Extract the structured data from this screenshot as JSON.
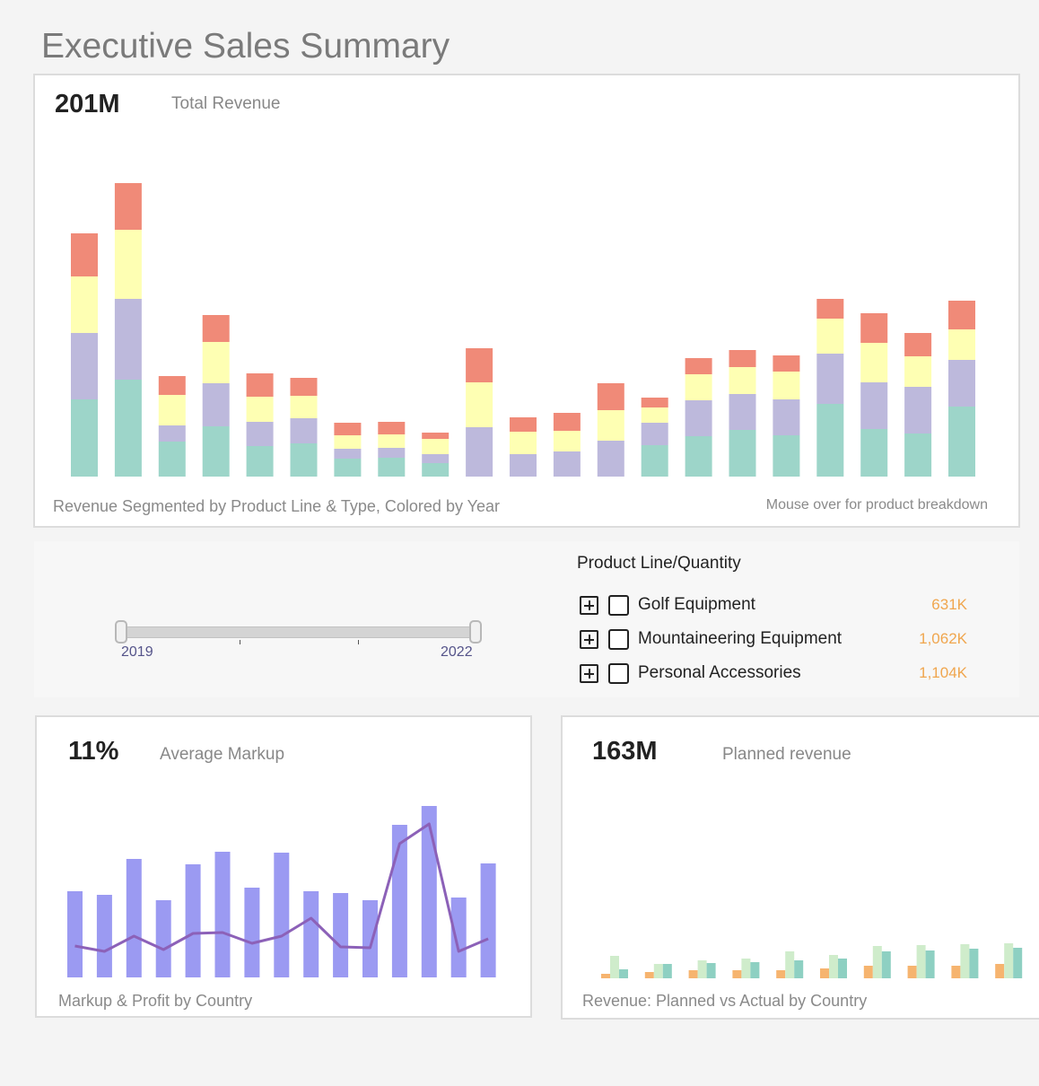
{
  "page": {
    "title": "Executive Sales Summary"
  },
  "revenue_panel": {
    "kpi_value": "201M",
    "kpi_label": "Total Revenue",
    "caption": "Revenue Segmented by Product Line & Type, Colored by Year",
    "hint": "Mouse over for product breakdown"
  },
  "filter": {
    "slider": {
      "min_label": "2019",
      "max_label": "2022"
    },
    "product_line_header": "Product Line/Quantity",
    "product_lines": [
      {
        "name": "Golf Equipment",
        "value": "631K"
      },
      {
        "name": "Mountaineering Equipment",
        "value": "1,062K"
      },
      {
        "name": "Personal Accessories",
        "value": "1,104K"
      }
    ]
  },
  "markup_panel": {
    "kpi_value": "11%",
    "kpi_label": "Average Markup",
    "caption": "Markup & Profit by Country"
  },
  "planned_panel": {
    "kpi_value": "163M",
    "kpi_label": "Planned revenue",
    "caption": "Revenue: Planned vs Actual by Country"
  },
  "chart_data": [
    {
      "type": "bar",
      "stacked": true,
      "title": "Revenue Segmented by Product Line & Type, Colored by Year",
      "colors": [
        "#9dd5c9",
        "#bdb9dc",
        "#feffb3",
        "#f08a78"
      ],
      "series": [
        {
          "values": [
            86,
            108,
            39,
            56,
            34,
            37,
            20,
            21,
            15,
            0,
            0,
            0,
            0,
            35,
            45,
            52,
            46,
            81,
            53,
            48,
            78
          ]
        },
        {
          "values": [
            74,
            90,
            18,
            48,
            27,
            28,
            11,
            11,
            10,
            55,
            25,
            28,
            40,
            25,
            40,
            40,
            40,
            56,
            52,
            52,
            52
          ]
        },
        {
          "values": [
            63,
            77,
            34,
            46,
            28,
            25,
            15,
            15,
            17,
            50,
            25,
            23,
            34,
            17,
            29,
            30,
            31,
            39,
            44,
            34,
            34
          ]
        },
        {
          "values": [
            48,
            52,
            21,
            30,
            26,
            20,
            14,
            14,
            7,
            38,
            16,
            20,
            30,
            11,
            18,
            19,
            18,
            22,
            33,
            26,
            32
          ]
        }
      ],
      "ylim": [
        0,
        330
      ]
    },
    {
      "type": "bar",
      "title": "Markup & Profit by Country",
      "bar_color": "#9b9af2",
      "line_color": "#8c61b8",
      "bars": [
        96,
        92,
        132,
        86,
        126,
        140,
        100,
        139,
        96,
        94,
        86,
        170,
        191,
        89,
        127
      ],
      "line": [
        35,
        29,
        46,
        31,
        49,
        50,
        38,
        46,
        66,
        34,
        33,
        149,
        171,
        29,
        43
      ],
      "ylim": [
        0,
        200
      ]
    },
    {
      "type": "bar",
      "title": "Revenue: Planned vs Actual by Country",
      "colors": [
        "#f6b46f",
        "#cfeccb",
        "#8ed0c2"
      ],
      "series": [
        {
          "values": [
            5,
            7,
            9,
            9,
            9,
            11,
            14,
            14,
            14,
            16
          ]
        },
        {
          "values": [
            25,
            16,
            20,
            22,
            30,
            26,
            36,
            37,
            38,
            39
          ]
        },
        {
          "values": [
            10,
            16,
            17,
            18,
            20,
            22,
            30,
            31,
            33,
            34
          ]
        }
      ],
      "ylim": [
        0,
        80
      ]
    }
  ]
}
